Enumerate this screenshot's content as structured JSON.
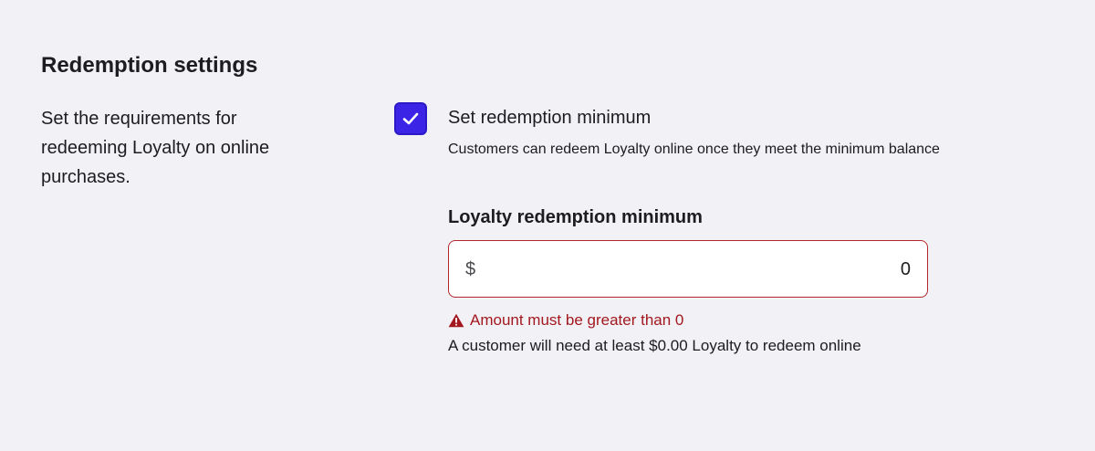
{
  "section": {
    "title": "Redemption settings",
    "description": "Set the requirements for redeeming Loyalty on online purchases."
  },
  "redemption_minimum_toggle": {
    "label": "Set redemption minimum",
    "help": "Customers can redeem Loyalty online once they meet the minimum balance",
    "checked": true,
    "icon": "checkmark-icon"
  },
  "minimum_field": {
    "label": "Loyalty redemption minimum",
    "prefix": "$",
    "value": "0",
    "error": "Amount must be greater than 0",
    "error_icon": "warning-triangle-icon",
    "hint": "A customer will need at least $0.00 Loyalty to redeem online"
  },
  "colors": {
    "background": "#f1f1f6",
    "checkbox_accent": "#3b24e6",
    "error": "#a3181f",
    "input_border_error": "#b3262d"
  }
}
